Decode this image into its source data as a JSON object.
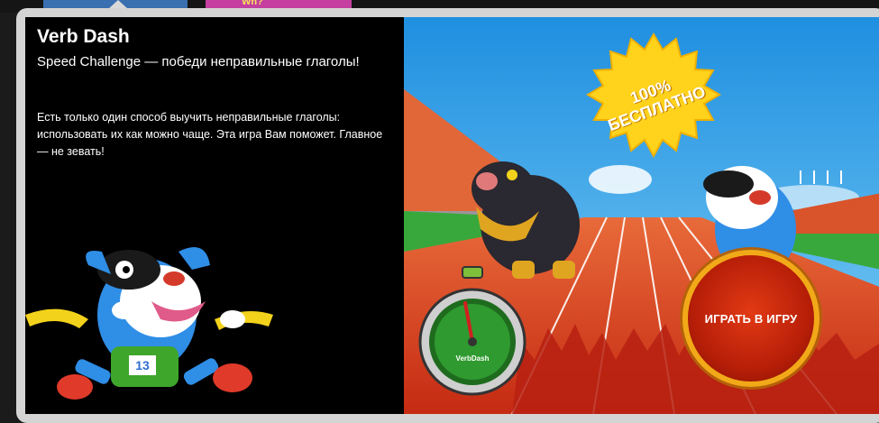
{
  "game": {
    "title": "Verb Dash",
    "subtitle": "Speed Challenge — победи неправильные глаголы!",
    "description": "Есть только один способ выучить неправильные глаголы: использовать их как можно чаще. Эта игра Вам поможет. Главное — не зевать!"
  },
  "badge": {
    "line1": "100%",
    "line2": "БЕСПЛАТНО"
  },
  "play_button": {
    "label": "ИГРАТЬ В ИГРУ"
  },
  "stopwatch": {
    "label": "VerbDash"
  },
  "runner": {
    "bib_number": "13"
  },
  "thumbnails": {
    "second_text": "Wh?"
  },
  "colors": {
    "track": "#d8431f",
    "sky": "#39a6e6",
    "badge": "#ffd21c",
    "button": "#c82a0c",
    "button_ring": "#f2a918"
  }
}
